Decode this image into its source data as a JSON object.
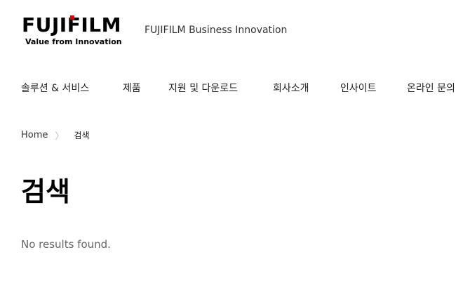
{
  "header": {
    "logo_text": "FUJIFILM",
    "logo_tagline": "Value from Innovation",
    "brand_name": "FUJIFILM Business Innovation"
  },
  "nav": {
    "items": [
      {
        "label": "솔루션 & 서비스"
      },
      {
        "label": "제품"
      },
      {
        "label": "지원 및 다운로드"
      },
      {
        "label": "회사소개"
      },
      {
        "label": "인사이트"
      },
      {
        "label": "온라인 문의"
      }
    ]
  },
  "breadcrumb": {
    "home": "Home",
    "separator": "〉",
    "current": "검색"
  },
  "main": {
    "title": "검색",
    "message": "No results found."
  },
  "colors": {
    "logo_accent": "#d40000",
    "text_primary": "#111111",
    "text_muted": "#666666"
  }
}
